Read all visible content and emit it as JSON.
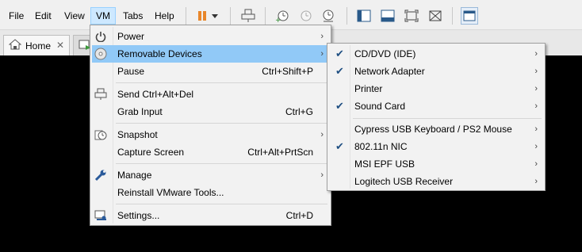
{
  "menubar": {
    "items": [
      "File",
      "Edit",
      "View",
      "VM",
      "Tabs",
      "Help"
    ]
  },
  "toolbar": {
    "icons": [
      "pause-icon",
      "dropdown-arrow-icon",
      "send-ctrl-alt-del-icon",
      "take-snapshot-icon",
      "revert-snapshot-icon",
      "snapshot-manager-icon",
      "show-library-icon",
      "thumbnail-bar-icon",
      "full-screen-icon",
      "unity-icon",
      "console-view-icon"
    ]
  },
  "tabs": {
    "home_label": "Home"
  },
  "vm_menu": {
    "items": [
      {
        "label": "Power",
        "shortcut": "",
        "submenu": true,
        "icon": "power-icon"
      },
      {
        "label": "Removable Devices",
        "shortcut": "",
        "submenu": true,
        "icon": "cd-icon",
        "highlighted": true
      },
      {
        "label": "Pause",
        "shortcut": "Ctrl+Shift+P",
        "submenu": false,
        "icon": ""
      },
      {
        "label": "Send Ctrl+Alt+Del",
        "shortcut": "",
        "submenu": false,
        "icon": "keyboard-icon"
      },
      {
        "label": "Grab Input",
        "shortcut": "Ctrl+G",
        "submenu": false,
        "icon": ""
      },
      {
        "label": "Snapshot",
        "shortcut": "",
        "submenu": true,
        "icon": "snapshot-icon"
      },
      {
        "label": "Capture Screen",
        "shortcut": "Ctrl+Alt+PrtScn",
        "submenu": false,
        "icon": ""
      },
      {
        "label": "Manage",
        "shortcut": "",
        "submenu": true,
        "icon": "wrench-icon"
      },
      {
        "label": "Reinstall VMware Tools...",
        "shortcut": "",
        "submenu": false,
        "icon": ""
      },
      {
        "label": "Settings...",
        "shortcut": "Ctrl+D",
        "submenu": false,
        "icon": "settings-icon"
      }
    ]
  },
  "devices_menu": {
    "items": [
      {
        "label": "CD/DVD (IDE)",
        "checked": true
      },
      {
        "label": "Network Adapter",
        "checked": true
      },
      {
        "label": "Printer",
        "checked": false
      },
      {
        "label": "Sound Card",
        "checked": true
      },
      {
        "label": "Cypress USB Keyboard / PS2 Mouse",
        "checked": false
      },
      {
        "label": "802.11n NIC",
        "checked": true
      },
      {
        "label": "MSI EPF USB",
        "checked": false
      },
      {
        "label": "Logitech USB Receiver",
        "checked": false
      }
    ]
  },
  "colors": {
    "highlight": "#91c9f7",
    "menubar_active": "#cde8ff",
    "vm_background": "#000000"
  }
}
